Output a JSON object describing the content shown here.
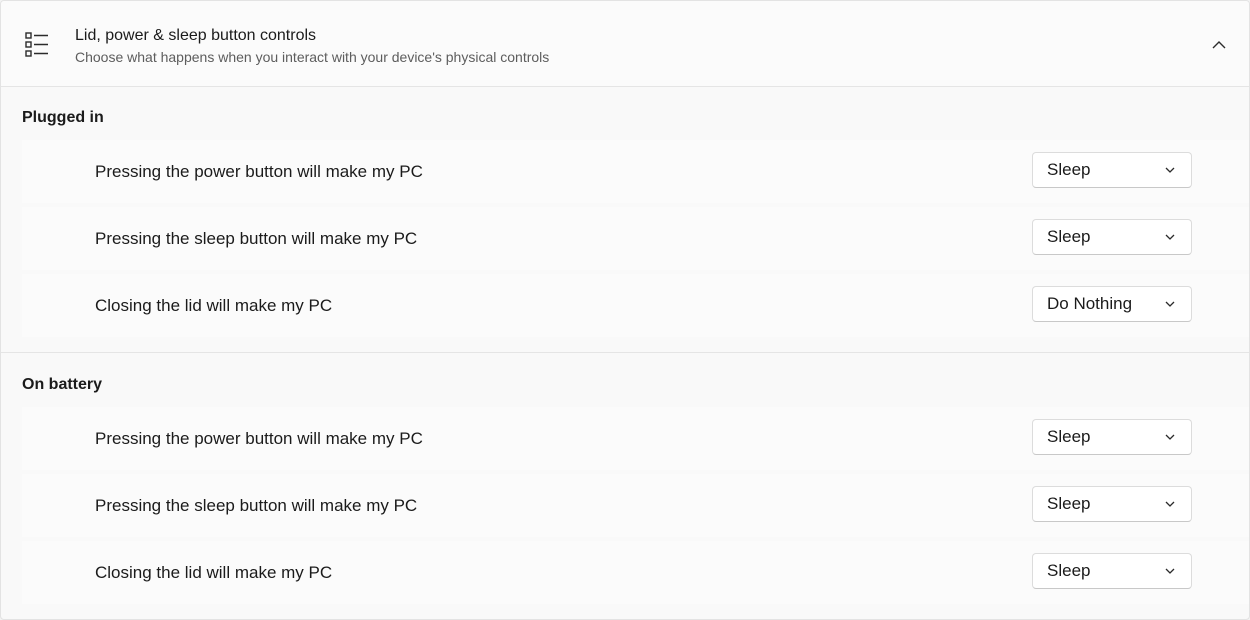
{
  "header": {
    "title": "Lid, power & sleep button controls",
    "subtitle": "Choose what happens when you interact with your device's physical controls",
    "icon": "list-settings-icon",
    "collapse_icon": "chevron-up-icon"
  },
  "sections": [
    {
      "title": "Plugged in",
      "rows": [
        {
          "label": "Pressing the power button will make my PC",
          "value": "Sleep"
        },
        {
          "label": "Pressing the sleep button will make my PC",
          "value": "Sleep"
        },
        {
          "label": "Closing the lid will make my PC",
          "value": "Do Nothing"
        }
      ]
    },
    {
      "title": "On battery",
      "rows": [
        {
          "label": "Pressing the power button will make my PC",
          "value": "Sleep"
        },
        {
          "label": "Pressing the sleep button will make my PC",
          "value": "Sleep"
        },
        {
          "label": "Closing the lid will make my PC",
          "value": "Sleep"
        }
      ]
    }
  ],
  "colors": {
    "background": "#f9f9f9",
    "card": "#fbfbfb",
    "text": "#1b1b1b",
    "secondary_text": "#5d5d5d"
  }
}
